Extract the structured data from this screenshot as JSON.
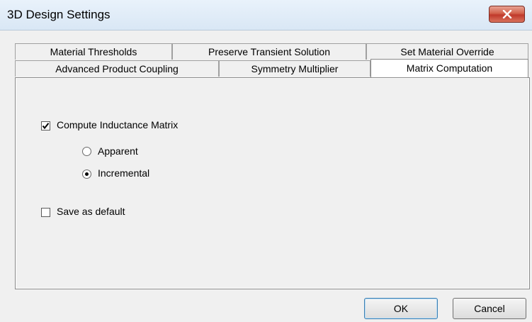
{
  "window": {
    "title": "3D Design Settings",
    "close_icon": "close-x-icon"
  },
  "tabs": {
    "back_row": [
      {
        "label": "Material Thresholds"
      },
      {
        "label": "Preserve Transient Solution"
      },
      {
        "label": "Set Material Override"
      }
    ],
    "front_row": [
      {
        "label": "Advanced Product Coupling"
      },
      {
        "label": "Symmetry Multiplier"
      },
      {
        "label": "Matrix Computation",
        "active": true
      }
    ]
  },
  "matrix_computation": {
    "compute_inductance": {
      "label": "Compute Inductance Matrix",
      "checked": true
    },
    "mode_options": [
      {
        "label": "Apparent",
        "selected": false
      },
      {
        "label": "Incremental",
        "selected": true
      }
    ],
    "save_default": {
      "label": "Save as default",
      "checked": false
    }
  },
  "buttons": {
    "ok": "OK",
    "cancel": "Cancel"
  }
}
